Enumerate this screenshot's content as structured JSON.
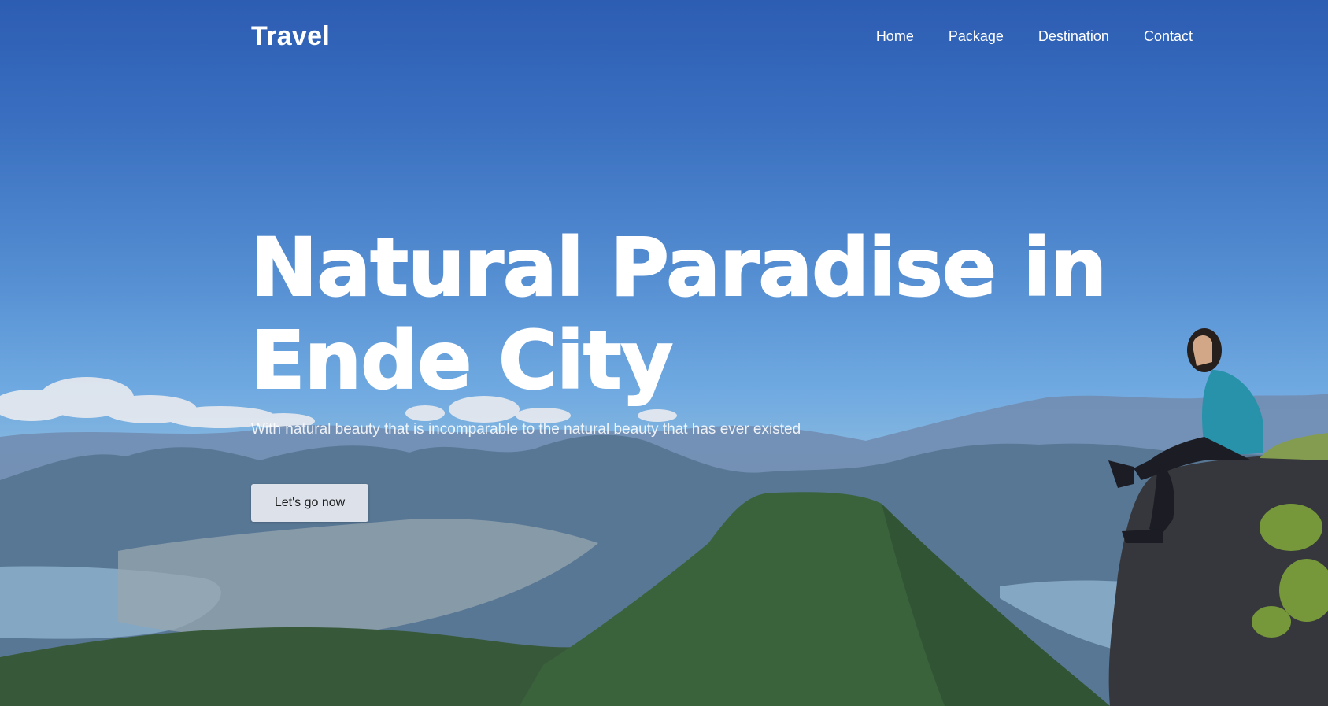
{
  "nav": {
    "brand": "Travel",
    "links": [
      "Home",
      "Package",
      "Destination",
      "Contact"
    ]
  },
  "hero": {
    "headline_line1": "Natural Paradise in",
    "headline_line2": "Ende City",
    "subtitle": "With natural beauty that is incomparable to the natural beauty that has ever existed",
    "cta_label": "Let's go now"
  },
  "colors": {
    "sky_top": "#2f63bd",
    "sky_horizon": "#8fc4ee",
    "mountain": "#3e6a3c",
    "text": "#ffffff",
    "button_bg": "#dde2ea"
  }
}
